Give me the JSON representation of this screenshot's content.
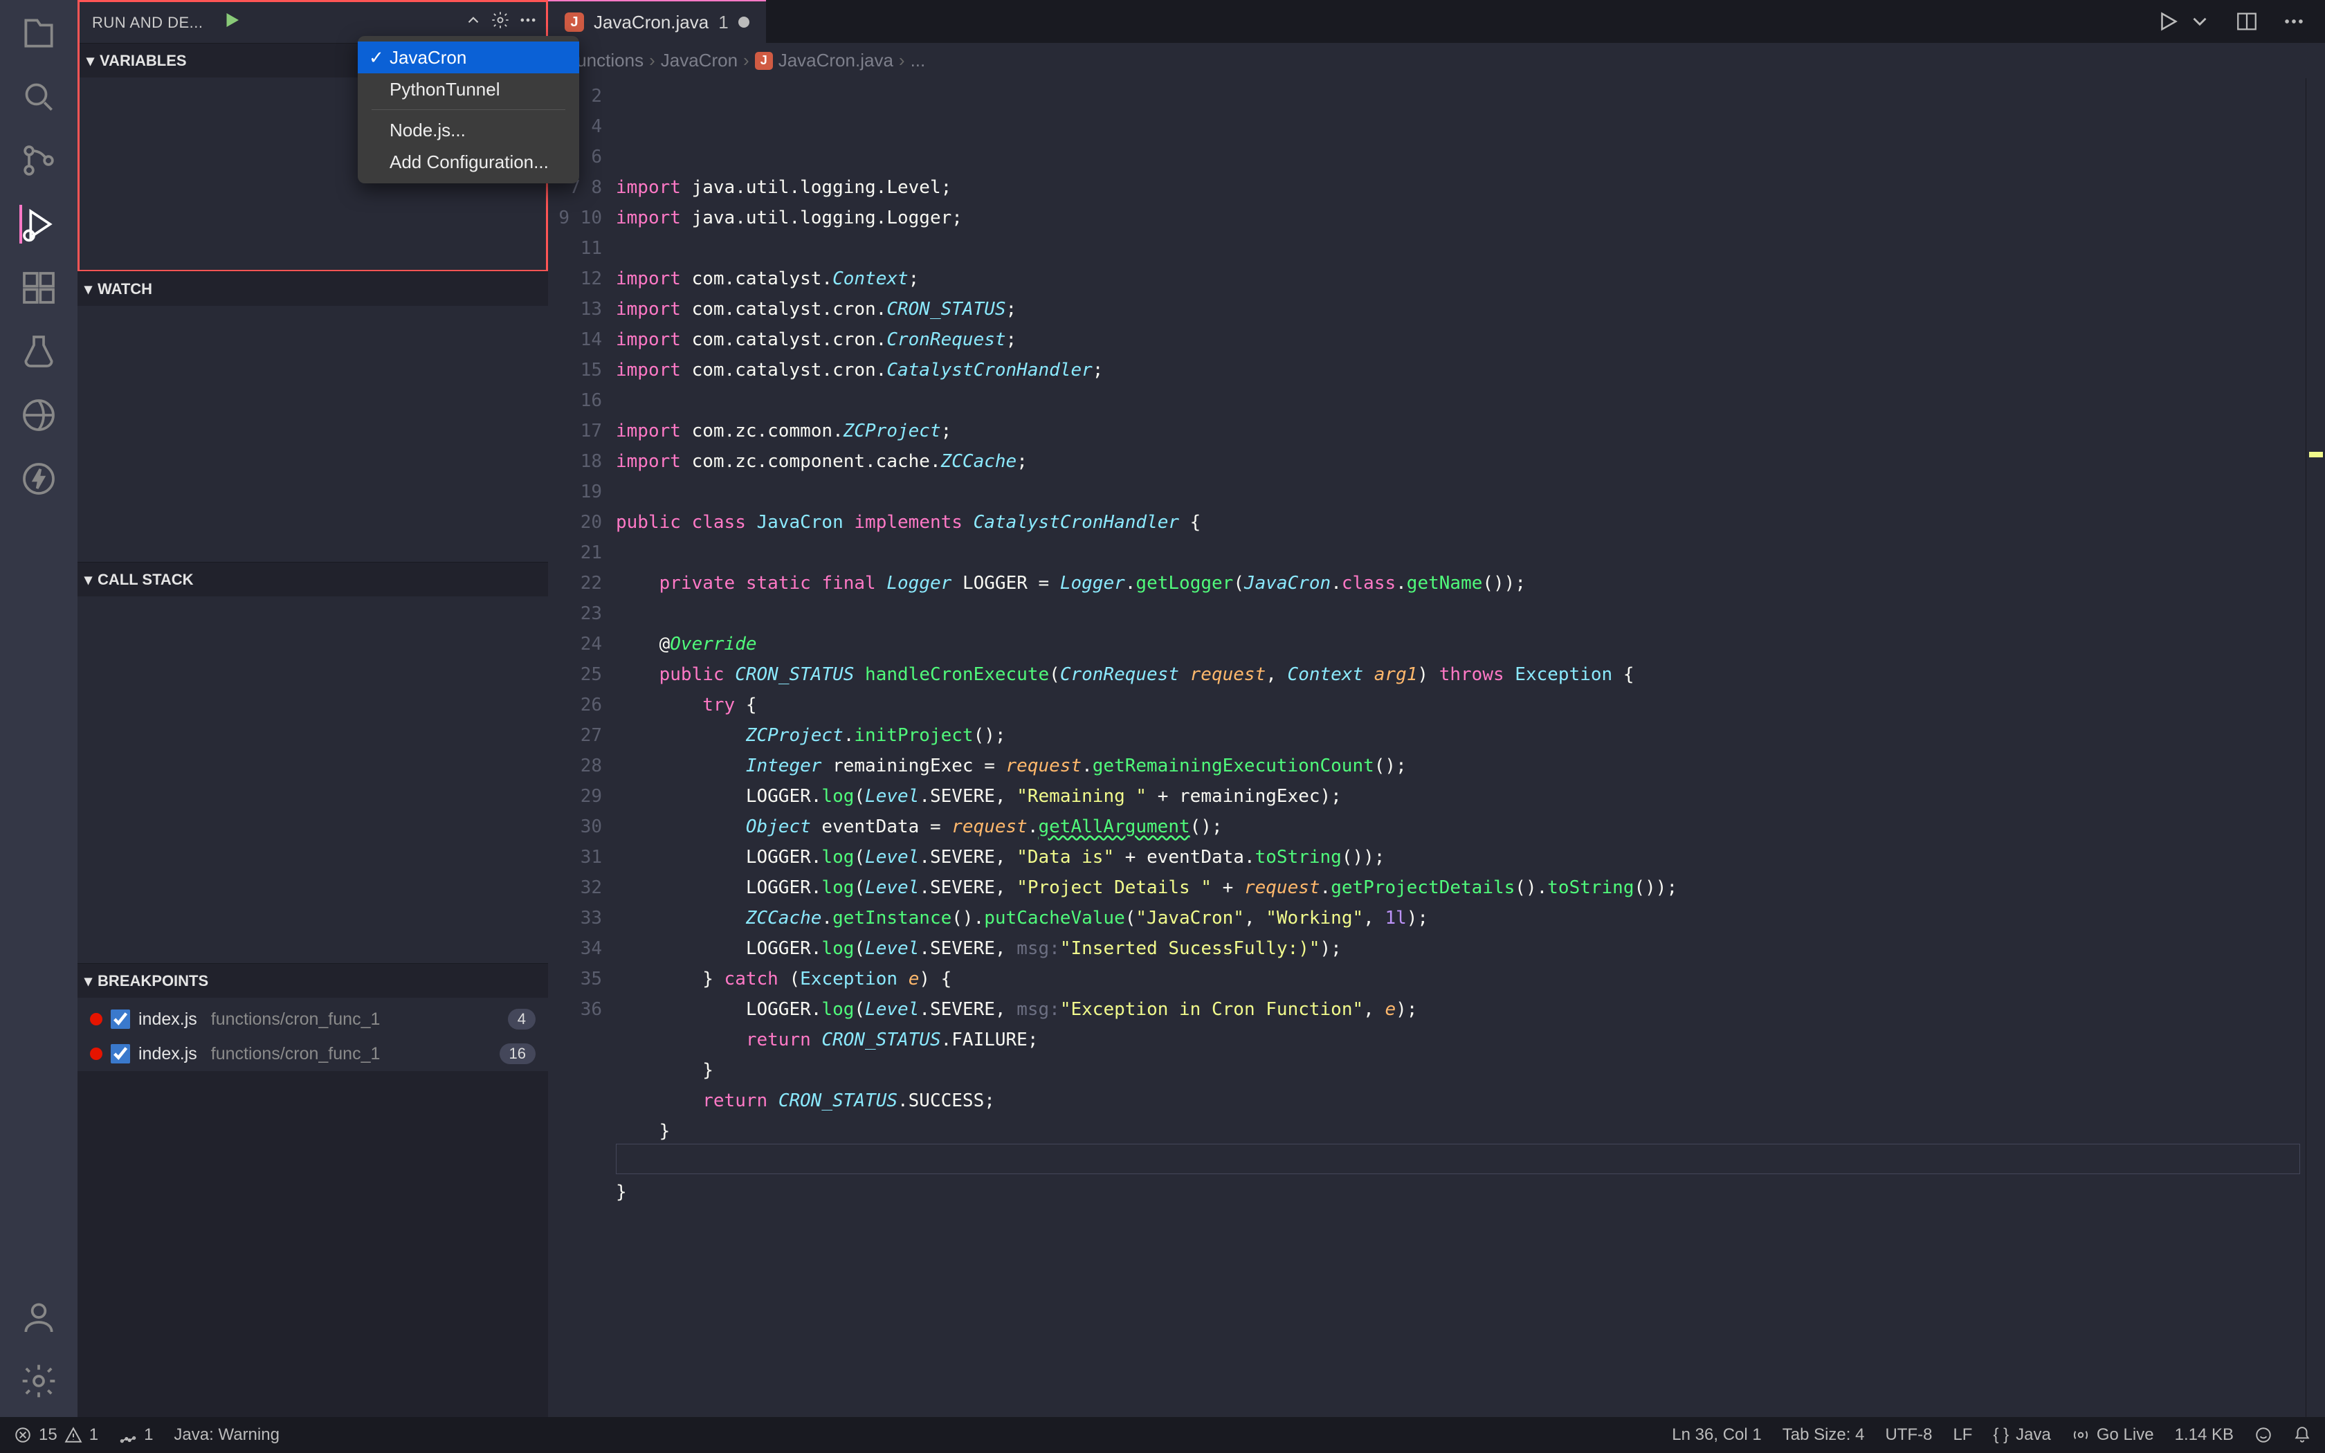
{
  "activitybar": {
    "items": [
      {
        "name": "explorer-icon"
      },
      {
        "name": "search-icon"
      },
      {
        "name": "source-control-icon"
      },
      {
        "name": "run-debug-icon",
        "active": true
      },
      {
        "name": "extensions-icon"
      },
      {
        "name": "testing-icon"
      },
      {
        "name": "live-share-icon"
      },
      {
        "name": "thunder-icon"
      }
    ],
    "bottom": [
      {
        "name": "account-icon"
      },
      {
        "name": "settings-gear-icon"
      }
    ]
  },
  "sidepanel": {
    "header": {
      "title": "RUN AND DE...",
      "selected_config": ""
    },
    "dropdown": {
      "options": [
        {
          "label": "JavaCron",
          "selected": true
        },
        {
          "label": "PythonTunnel",
          "selected": false
        }
      ],
      "extra": [
        {
          "label": "Node.js..."
        },
        {
          "label": "Add Configuration..."
        }
      ]
    },
    "sections": {
      "variables": "VARIABLES",
      "watch": "WATCH",
      "callstack": "CALL STACK",
      "breakpoints": "BREAKPOINTS"
    },
    "breakpoints": [
      {
        "file": "index.js",
        "path": "functions/cron_func_1",
        "line": "4",
        "checked": true
      },
      {
        "file": "index.js",
        "path": "functions/cron_func_1",
        "line": "16",
        "checked": true
      }
    ]
  },
  "tab": {
    "filename": "JavaCron.java",
    "badge": "1"
  },
  "breadcrumb": {
    "a": "functions",
    "b": "JavaCron",
    "c": "JavaCron.java",
    "d": "..."
  },
  "code": {
    "lines": 36
  },
  "statusbar": {
    "errors": "15",
    "warnings": "1",
    "otherCount": "1",
    "javaStatus": "Java: Warning",
    "position": "Ln 36, Col 1",
    "tabsize": "Tab Size: 4",
    "encoding": "UTF-8",
    "eol": "LF",
    "language": "Java",
    "golive": "Go Live",
    "filesize": "1.14 KB"
  }
}
